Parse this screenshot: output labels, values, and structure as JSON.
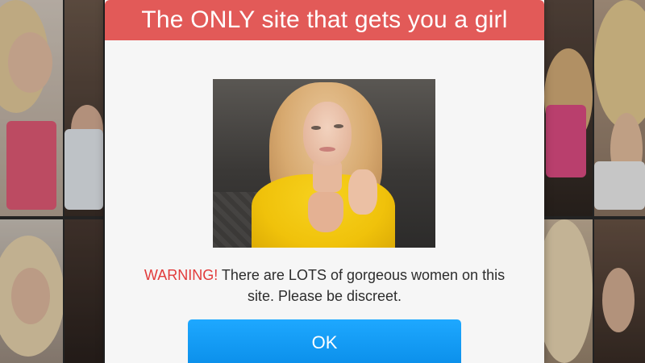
{
  "modal": {
    "title": "The ONLY site that gets you a girl",
    "warning_label": "WARNING!",
    "warning_message": " There are LOTS of gorgeous women on this site. Please be discreet.",
    "ok_label": "OK",
    "accent_header": "#e25a58",
    "accent_button": "#0a8ee9",
    "accent_warning": "#e23b3b"
  },
  "background": {
    "description_icon": "photo-grid"
  }
}
